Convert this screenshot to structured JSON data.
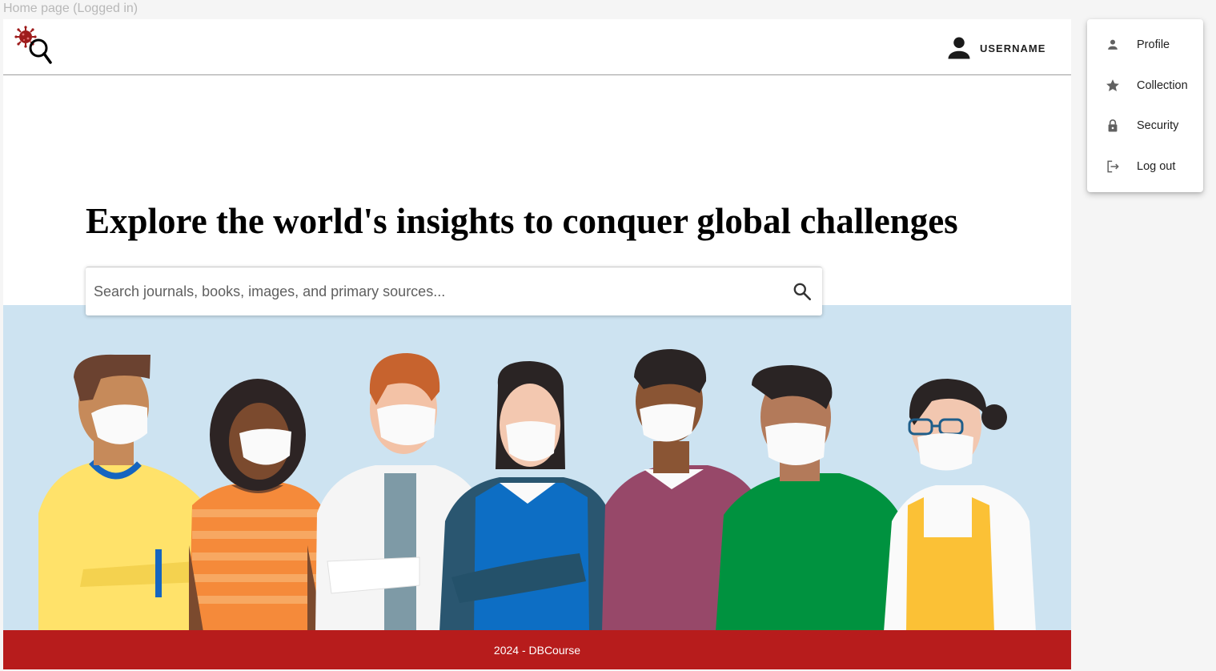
{
  "window": {
    "title": "Home page (Logged in)"
  },
  "header": {
    "username": "USERNAME"
  },
  "hero": {
    "title": "Explore the world's insights to conquer global challenges"
  },
  "search": {
    "placeholder": "Search journals, books, images, and primary sources..."
  },
  "user_menu": {
    "items": [
      {
        "label": "Profile",
        "icon": "person-icon"
      },
      {
        "label": "Collection",
        "icon": "star-icon"
      },
      {
        "label": "Security",
        "icon": "lock-icon"
      },
      {
        "label": "Log out",
        "icon": "logout-icon"
      }
    ]
  },
  "footer": {
    "text": "2024 - DBCourse"
  },
  "colors": {
    "brand_red": "#b71c1c",
    "banner_bg": "#cde3f1",
    "icon_grey": "#616161",
    "text_dark": "#212121"
  }
}
